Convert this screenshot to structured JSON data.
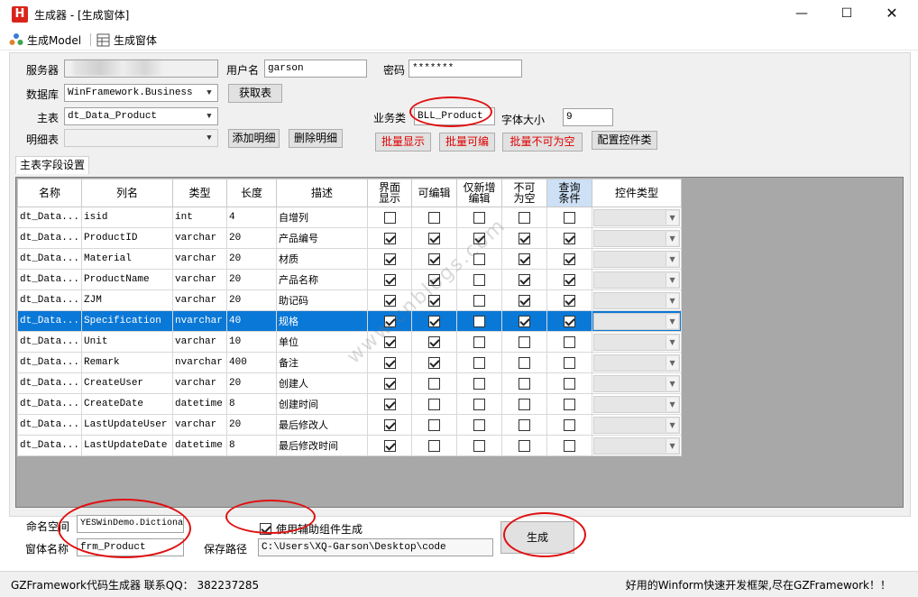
{
  "window": {
    "title": "生成器 - [生成窗体]",
    "minimize": "—",
    "maximize": "☐",
    "close": "✕",
    "app_icon_letter": "H"
  },
  "menu": {
    "model_label": "生成Model",
    "form_label": "生成窗体"
  },
  "form": {
    "server_label": "服务器",
    "user_label": "用户名",
    "user_value": "garson",
    "password_label": "密码",
    "password_value": "*******",
    "database_label": "数据库",
    "database_value": "WinFramework.Business",
    "get_table_button": "获取表",
    "main_table_label": "主表",
    "main_table_value": "dt_Data_Product",
    "detail_table_label": "明细表",
    "detail_table_value": "",
    "add_detail_button": "添加明细",
    "delete_detail_button": "删除明细",
    "business_class_label": "业务类",
    "business_class_value": "BLL_Product",
    "font_size_label": "字体大小",
    "font_size_value": "9",
    "batch_show_button": "批量显示",
    "batch_edit_button": "批量可编",
    "batch_not_null_button": "批量不可为空",
    "config_control_button": "配置控件类"
  },
  "tab": {
    "label": "主表字段设置"
  },
  "grid": {
    "headers": [
      "名称",
      "列名",
      "类型",
      "长度",
      "描述",
      "界面\n显示",
      "可编辑",
      "仅新增\n编辑",
      "不可\n为空",
      "查询\n条件",
      "控件类型"
    ],
    "rows": [
      {
        "name": "dt_Data...",
        "column": "isid",
        "type": "int",
        "length": "4",
        "desc": "自增列",
        "show": false,
        "edit": false,
        "add_only": false,
        "not_null": false,
        "query": false
      },
      {
        "name": "dt_Data...",
        "column": "ProductID",
        "type": "varchar",
        "length": "20",
        "desc": "产品编号",
        "show": true,
        "edit": true,
        "add_only": true,
        "not_null": true,
        "query": true
      },
      {
        "name": "dt_Data...",
        "column": "Material",
        "type": "varchar",
        "length": "20",
        "desc": "材质",
        "show": true,
        "edit": true,
        "add_only": false,
        "not_null": true,
        "query": true
      },
      {
        "name": "dt_Data...",
        "column": "ProductName",
        "type": "varchar",
        "length": "20",
        "desc": "产品名称",
        "show": true,
        "edit": true,
        "add_only": false,
        "not_null": true,
        "query": true
      },
      {
        "name": "dt_Data...",
        "column": "ZJM",
        "type": "varchar",
        "length": "20",
        "desc": "助记码",
        "show": true,
        "edit": true,
        "add_only": false,
        "not_null": true,
        "query": true
      },
      {
        "name": "dt_Data...",
        "column": "Specification",
        "type": "nvarchar",
        "length": "40",
        "desc": "规格",
        "show": true,
        "edit": true,
        "add_only": false,
        "not_null": true,
        "query": true,
        "selected": true
      },
      {
        "name": "dt_Data...",
        "column": "Unit",
        "type": "varchar",
        "length": "10",
        "desc": "单位",
        "show": true,
        "edit": true,
        "add_only": false,
        "not_null": false,
        "query": false
      },
      {
        "name": "dt_Data...",
        "column": "Remark",
        "type": "nvarchar",
        "length": "400",
        "desc": "备注",
        "show": true,
        "edit": true,
        "add_only": false,
        "not_null": false,
        "query": false
      },
      {
        "name": "dt_Data...",
        "column": "CreateUser",
        "type": "varchar",
        "length": "20",
        "desc": "创建人",
        "show": true,
        "edit": false,
        "add_only": false,
        "not_null": false,
        "query": false
      },
      {
        "name": "dt_Data...",
        "column": "CreateDate",
        "type": "datetime",
        "length": "8",
        "desc": "创建时间",
        "show": true,
        "edit": false,
        "add_only": false,
        "not_null": false,
        "query": false
      },
      {
        "name": "dt_Data...",
        "column": "LastUpdateUser",
        "type": "varchar",
        "length": "20",
        "desc": "最后修改人",
        "show": true,
        "edit": false,
        "add_only": false,
        "not_null": false,
        "query": false
      },
      {
        "name": "dt_Data...",
        "column": "LastUpdateDate",
        "type": "datetime",
        "length": "8",
        "desc": "最后修改时间",
        "show": true,
        "edit": false,
        "add_only": false,
        "not_null": false,
        "query": false
      }
    ]
  },
  "bottom": {
    "namespace_label": "命名空间",
    "namespace_value": "YESWinDemo.Dictiona",
    "form_name_label": "窗体名称",
    "form_name_value": "frm_Product",
    "use_helper_label": "使用辅助组件生成",
    "use_helper_checked": true,
    "save_path_label": "保存路径",
    "save_path_value": "C:\\Users\\XQ-Garson\\Desktop\\code",
    "generate_button": "生成"
  },
  "status": {
    "left": "GZFramework代码生成器  联系QQ：  382237285",
    "right": "好用的Winform快速开发框架,尽在GZFramework！！"
  },
  "watermark": "www.cnblogs.com",
  "colors": {
    "selected_row": "#0a78d7",
    "annotation": "#e01010",
    "red_button_text": "#e00000"
  }
}
